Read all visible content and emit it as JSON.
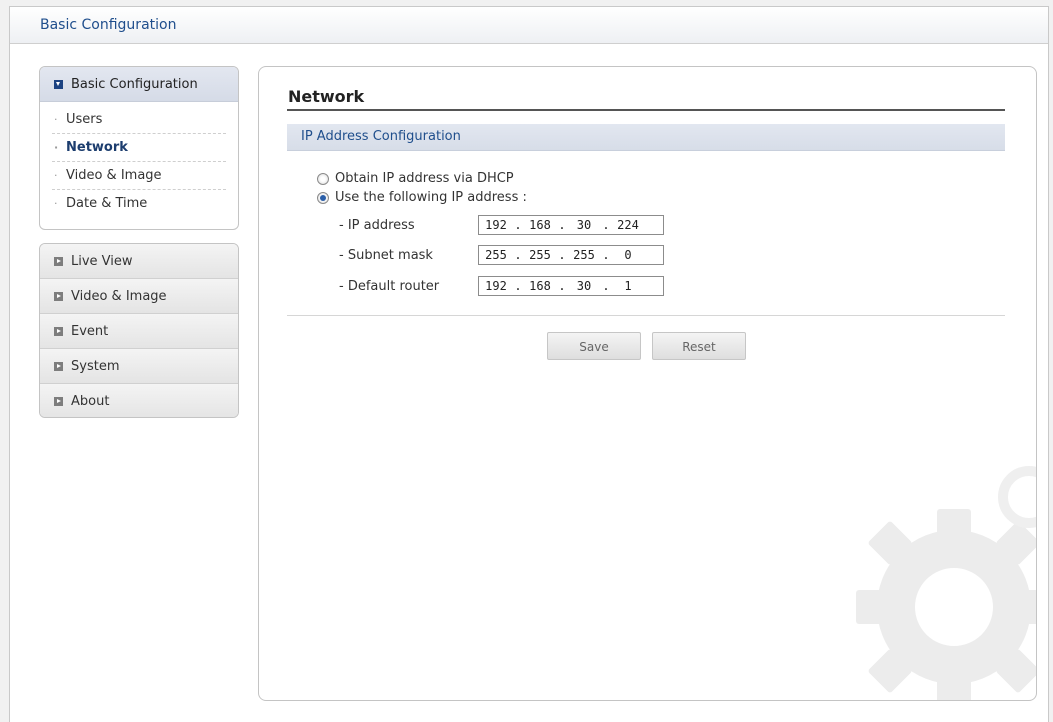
{
  "window": {
    "title": "Basic Configuration"
  },
  "sidebar": {
    "section_title": "Basic Configuration",
    "sub_items": [
      {
        "label": "Users",
        "active": false
      },
      {
        "label": "Network",
        "active": true
      },
      {
        "label": "Video & Image",
        "active": false
      },
      {
        "label": "Date & Time",
        "active": false
      }
    ],
    "nav_items": [
      {
        "label": "Live View"
      },
      {
        "label": "Video & Image"
      },
      {
        "label": "Event"
      },
      {
        "label": "System"
      },
      {
        "label": "About"
      }
    ]
  },
  "main": {
    "title": "Network",
    "section_title": "IP Address Configuration",
    "options": {
      "dhcp_label": "Obtain IP address via DHCP",
      "static_label": "Use the following IP address :",
      "selected": "static"
    },
    "fields": {
      "ip_label": "- IP address",
      "ip": [
        "192",
        "168",
        "30",
        "224"
      ],
      "subnet_label": "- Subnet mask",
      "subnet": [
        "255",
        "255",
        "255",
        "0"
      ],
      "router_label": "- Default router",
      "router": [
        "192",
        "168",
        "30",
        "1"
      ]
    },
    "buttons": {
      "save": "Save",
      "reset": "Reset"
    }
  },
  "colors": {
    "accent": "#1f4e8c",
    "header_bg": "#d7dde8",
    "watermark": "#eeeeee"
  },
  "icons": {
    "section_checkbox": "checked-box-icon",
    "nav_arrow": "expand-arrow-icon",
    "watermark": "gear-icon"
  }
}
